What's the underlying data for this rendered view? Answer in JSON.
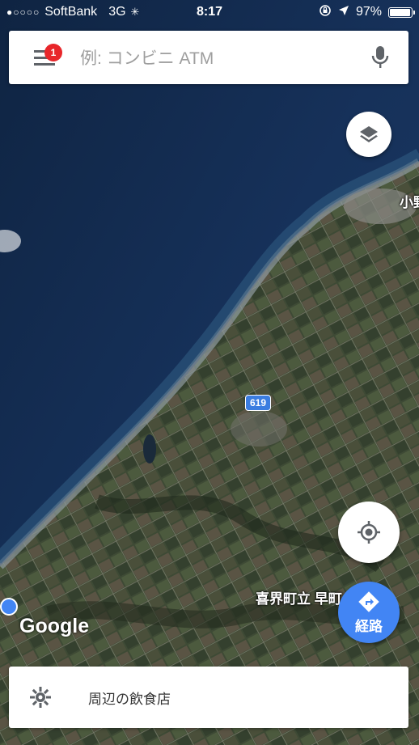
{
  "status_bar": {
    "signal": "●○○○○",
    "carrier": "SoftBank",
    "network": "3G",
    "time": "8:17",
    "battery_text": "97%",
    "battery_level": 0.97
  },
  "search": {
    "placeholder": "例: コンビニ ATM",
    "notification_count": "1"
  },
  "map": {
    "labels": {
      "island_partial": "小野",
      "town_partial": "喜界町立 早町"
    },
    "route_number": "619",
    "logo": "Google"
  },
  "directions_button": {
    "label": "経路"
  },
  "bottom_card": {
    "label": "周辺の飲食店"
  },
  "icons": {
    "menu": "menu-icon",
    "mic": "mic-icon",
    "layers": "layers-icon",
    "location": "my-location-icon",
    "directions": "directions-icon",
    "restaurant": "restaurant-icon"
  },
  "colors": {
    "accent_blue": "#4285f4",
    "badge_red": "#e8262a",
    "sea": "#14294a",
    "land": "#3c4a33"
  }
}
